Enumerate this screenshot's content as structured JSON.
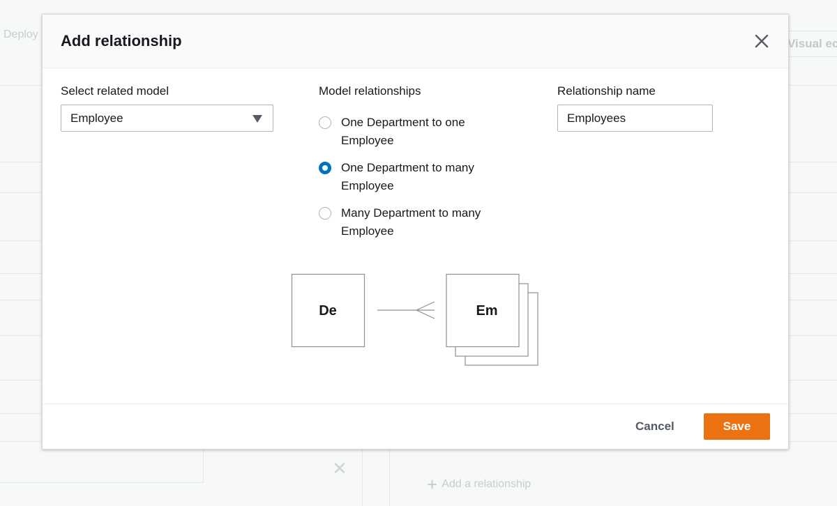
{
  "background": {
    "deploy_label": "Deploy",
    "visual_label": "Visual ec",
    "add_relationship_label": "Add a relationship"
  },
  "modal": {
    "title": "Add relationship",
    "related_model": {
      "label": "Select related model",
      "value": "Employee"
    },
    "model_relationships": {
      "label": "Model relationships",
      "options": [
        {
          "label": "One Department to one Employee",
          "checked": false
        },
        {
          "label": "One Department to many Employee",
          "checked": true
        },
        {
          "label": "Many Department to many Employee",
          "checked": false
        }
      ]
    },
    "relationship_name": {
      "label": "Relationship name",
      "value": "Employees"
    },
    "diagram": {
      "left_box": "De",
      "right_box": "Em"
    },
    "footer": {
      "cancel_label": "Cancel",
      "save_label": "Save"
    }
  },
  "colors": {
    "accent": "#ec7211",
    "radio_selected": "#0073bb"
  }
}
